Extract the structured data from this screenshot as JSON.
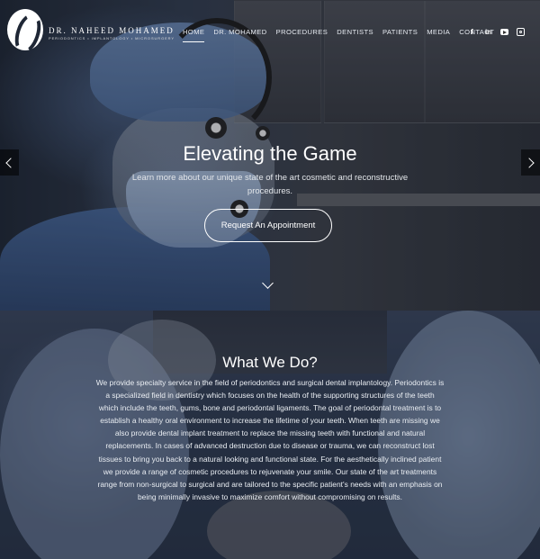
{
  "brand": {
    "name": "DR. NAHEED MOHAMED",
    "tagline": "PERIODONTICS • IMPLANTOLOGY • MICROSURGERY"
  },
  "nav": {
    "items": [
      {
        "label": "HOME",
        "active": true
      },
      {
        "label": "DR. MOHAMED",
        "active": false
      },
      {
        "label": "PROCEDURES",
        "active": false
      },
      {
        "label": "DENTISTS",
        "active": false
      },
      {
        "label": "PATIENTS",
        "active": false
      },
      {
        "label": "MEDIA",
        "active": false
      },
      {
        "label": "CONTACT",
        "active": false
      }
    ]
  },
  "social": {
    "facebook": "f",
    "linkedin": "in"
  },
  "hero": {
    "title": "Elevating the Game",
    "subtitle": "Learn more about our unique state of the art cosmetic and reconstructive procedures.",
    "cta_label": "Request An Appointment"
  },
  "what_we_do": {
    "title": "What We Do?",
    "body": "We provide specialty service in the field of periodontics and surgical dental implantology. Periodontics is a specialized field in dentistry which focuses on the health of the supporting structures of the teeth which include the teeth, gums, bone and periodontal ligaments. The goal of periodontal treatment is to establish a healthy oral environment to increase the lifetime of your teeth. When teeth are missing we also provide dental implant treatment to replace the missing teeth with functional and natural replacements. In cases of advanced destruction due to disease or trauma, we can reconstruct lost tissues to bring you back to a natural looking and functional state. For the aesthetically inclined patient we provide a range of cosmetic procedures to rejuvenate your smile. Our state of the art treatments range from non-surgical to surgical and are tailored to the specific patient's needs with an emphasis on being minimally invasive to maximize comfort without compromising on results."
  },
  "icons": {
    "logo": "logo-mark",
    "prev": "chevron-left-icon",
    "next": "chevron-right-icon",
    "scroll": "chevron-down-icon",
    "youtube": "youtube-icon",
    "instagram": "instagram-icon"
  }
}
